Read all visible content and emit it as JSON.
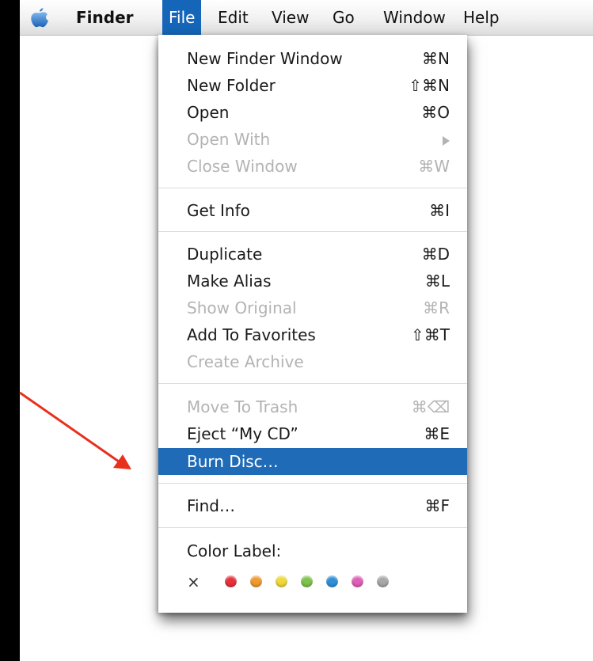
{
  "menubar": {
    "items": [
      {
        "label": "Finder"
      },
      {
        "label": "File"
      },
      {
        "label": "Edit"
      },
      {
        "label": "View"
      },
      {
        "label": "Go"
      },
      {
        "label": "Window"
      },
      {
        "label": "Help"
      }
    ],
    "apple_icon": "apple-logo-icon"
  },
  "menu": {
    "items": [
      {
        "label": "New Finder Window",
        "shortcut": "⌘N"
      },
      {
        "label": "New Folder",
        "shortcut": "⇧⌘N"
      },
      {
        "label": "Open",
        "shortcut": "⌘O"
      },
      {
        "label": "Open With",
        "shortcut": ""
      },
      {
        "label": "Close Window",
        "shortcut": "⌘W"
      },
      {
        "label": "Get Info",
        "shortcut": "⌘I"
      },
      {
        "label": "Duplicate",
        "shortcut": "⌘D"
      },
      {
        "label": "Make Alias",
        "shortcut": "⌘L"
      },
      {
        "label": "Show Original",
        "shortcut": "⌘R"
      },
      {
        "label": "Add To Favorites",
        "shortcut": "⇧⌘T"
      },
      {
        "label": "Create Archive",
        "shortcut": ""
      },
      {
        "label": "Move To Trash",
        "shortcut": "⌘⌫"
      },
      {
        "label": "Eject “My CD”",
        "shortcut": "⌘E"
      },
      {
        "label": "Burn Disc…",
        "shortcut": ""
      },
      {
        "label": "Find…",
        "shortcut": "⌘F"
      }
    ],
    "color_label": {
      "heading": "Color Label:",
      "none_symbol": "×",
      "colors": [
        "#e8303a",
        "#f29a2e",
        "#f0da3a",
        "#7ec34a",
        "#2f8fd8",
        "#e060b8",
        "#a8a8a8"
      ]
    }
  },
  "colors": {
    "highlight": "#1f6bb7",
    "menubar_highlight": "#1565b8",
    "disabled_text": "#b3b3b3",
    "annotation_arrow": "#e8301c"
  }
}
